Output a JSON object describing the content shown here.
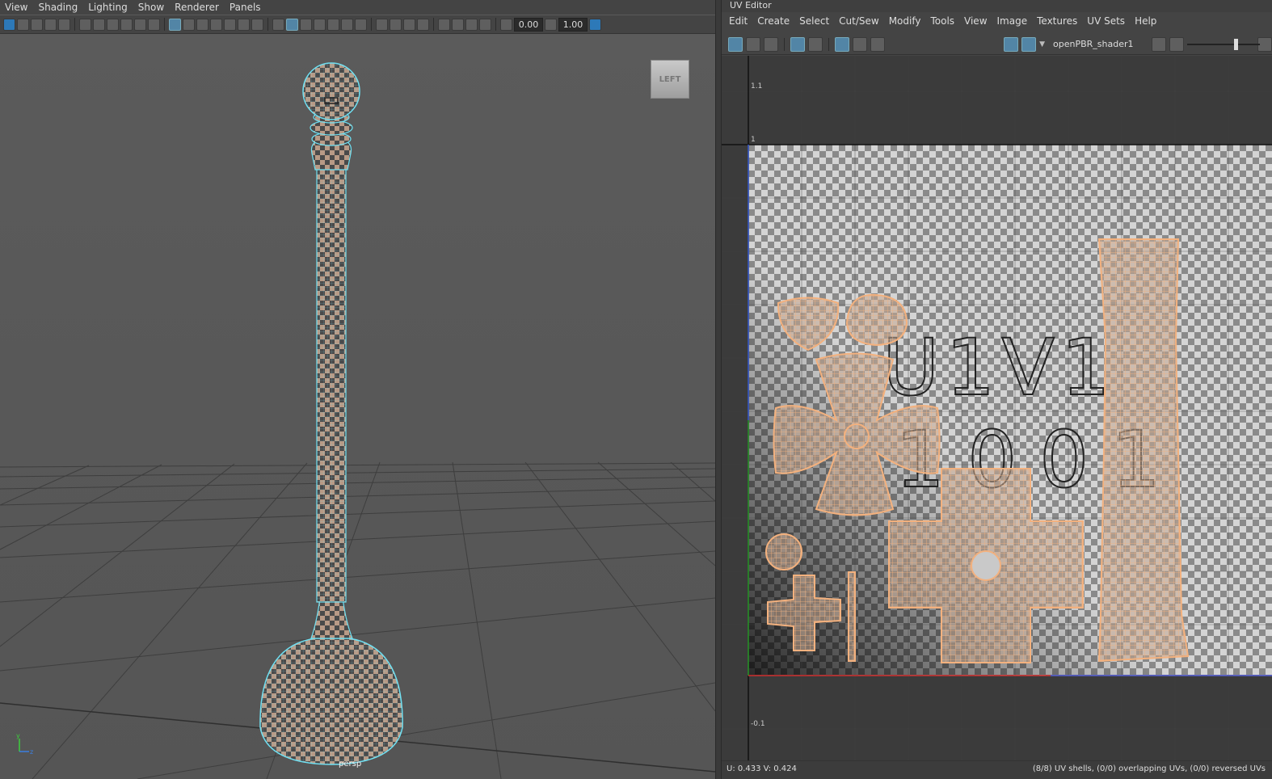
{
  "viewport": {
    "menu": [
      "View",
      "Shading",
      "Lighting",
      "Show",
      "Renderer",
      "Panels"
    ],
    "field_1": "0.00",
    "field_2": "1.00",
    "view_cube_label": "LEFT",
    "camera_label": "persp",
    "axis_labels": {
      "y": "y",
      "z": "z"
    }
  },
  "uv_editor": {
    "title": "UV Editor",
    "menu": [
      "Edit",
      "Create",
      "Select",
      "Cut/Sew",
      "Modify",
      "Tools",
      "View",
      "Image",
      "Textures",
      "UV Sets",
      "Help"
    ],
    "shader_name": "openPBR_shader1",
    "ruler": {
      "v_top": "1.1",
      "v_one": "1",
      "v_neg": "-0.1"
    },
    "tile_label_1": "U1V1",
    "tile_label_2": "1001",
    "status": {
      "coords": "U:  0.433  V:  0.424",
      "shell_info": "(8/8) UV shells, (0/0) overlapping UVs, (0/0) reversed UVs"
    },
    "colors": {
      "uv_shell": "#f3b17e",
      "u_axis": "#d03030",
      "v_axis": "#2b9a2b",
      "border_blue": "#3b5fd6"
    }
  }
}
